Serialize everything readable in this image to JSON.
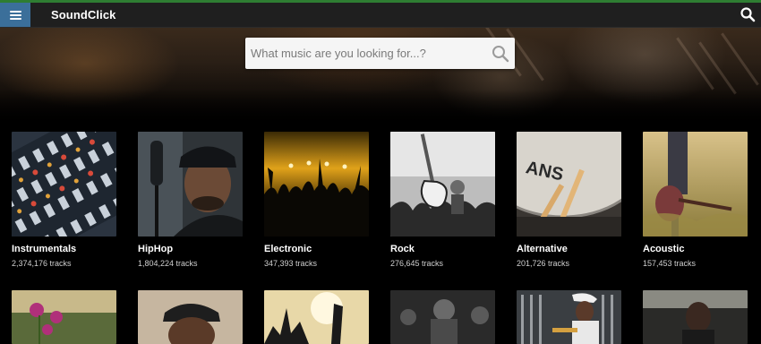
{
  "navbar": {
    "brand": "SoundClick",
    "menu_icon": "hamburger-menu-icon",
    "search_icon": "search-icon"
  },
  "hero": {
    "search_placeholder": "What music are you looking for...?",
    "search_icon": "search-icon"
  },
  "colors": {
    "menu_button": "#3b6f9a",
    "top_accent": "#2e7d32",
    "navbar_bg": "#1f1f1f",
    "page_bg": "#000000"
  },
  "genres": [
    {
      "name": "Instrumentals",
      "count": "2,374,176 tracks"
    },
    {
      "name": "HipHop",
      "count": "1,804,224 tracks"
    },
    {
      "name": "Electronic",
      "count": "347,393 tracks"
    },
    {
      "name": "Rock",
      "count": "276,645 tracks"
    },
    {
      "name": "Alternative",
      "count": "201,726 tracks"
    },
    {
      "name": "Acoustic",
      "count": "157,453 tracks"
    }
  ]
}
